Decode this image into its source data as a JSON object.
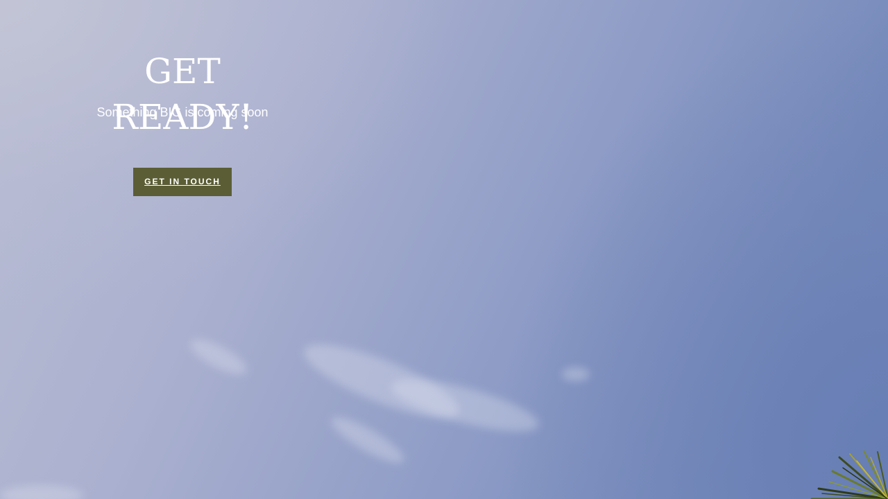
{
  "hero": {
    "title": "GET READY!",
    "subtitle": "Something BIG is coming soon",
    "cta_label": "GET IN TOUCH"
  },
  "colors": {
    "button_background": "#5b5d35",
    "text": "#ffffff",
    "sky_light": "#b9bdd3",
    "sky_dark": "#6f86b9"
  },
  "icons": {
    "corner_decoration": "palm-leaves"
  }
}
